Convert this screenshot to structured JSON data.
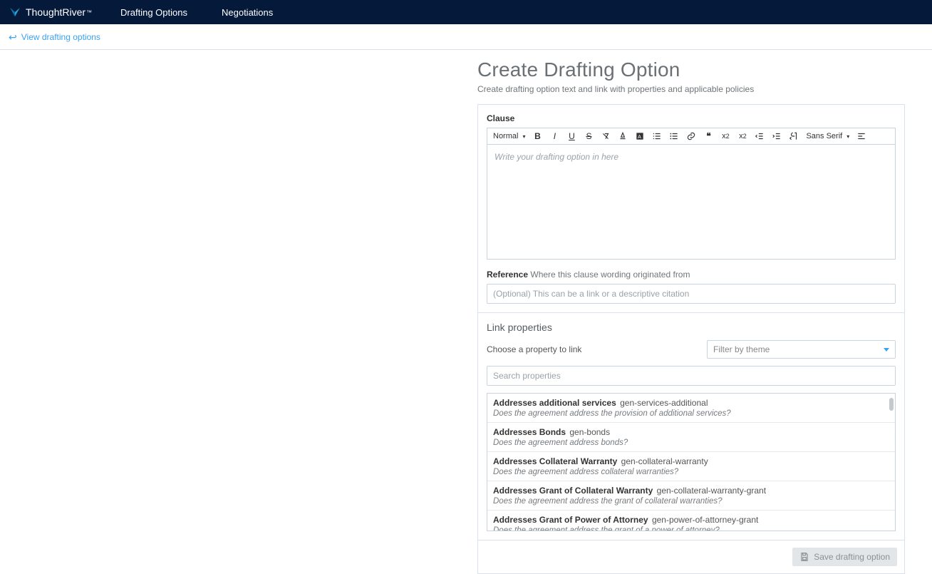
{
  "brand": {
    "name": "ThoughtRiver"
  },
  "nav": {
    "drafting": "Drafting Options",
    "negotiations": "Negotiations"
  },
  "breadcrumb": {
    "back": "View drafting options"
  },
  "page": {
    "title": "Create Drafting Option",
    "subtitle": "Create drafting option text and link with properties and applicable policies"
  },
  "clause": {
    "label": "Clause",
    "placeholder": "Write your drafting option in here",
    "toolbar": {
      "format": "Normal",
      "font": "Sans Serif"
    }
  },
  "reference": {
    "label": "Reference",
    "hint": "Where this clause wording originated from",
    "placeholder": "(Optional) This can be a link or a descriptive citation"
  },
  "link_props": {
    "title": "Link properties",
    "choose": "Choose a property to link",
    "filter_placeholder": "Filter by theme",
    "search_placeholder": "Search properties",
    "items": [
      {
        "name": "Addresses additional services",
        "code": "gen-services-additional",
        "q": "Does the agreement address the provision of additional services?"
      },
      {
        "name": "Addresses Bonds",
        "code": "gen-bonds",
        "q": "Does the agreement address bonds?"
      },
      {
        "name": "Addresses Collateral Warranty",
        "code": "gen-collateral-warranty",
        "q": "Does the agreement address collateral warranties?"
      },
      {
        "name": "Addresses Grant of Collateral Warranty",
        "code": "gen-collateral-warranty-grant",
        "q": "Does the agreement address the grant of collateral warranties?"
      },
      {
        "name": "Addresses Grant of Power of Attorney",
        "code": "gen-power-of-attorney-grant",
        "q": "Does the agreement address the grant of a power of attorney?"
      }
    ]
  },
  "footer": {
    "save": "Save drafting option"
  }
}
